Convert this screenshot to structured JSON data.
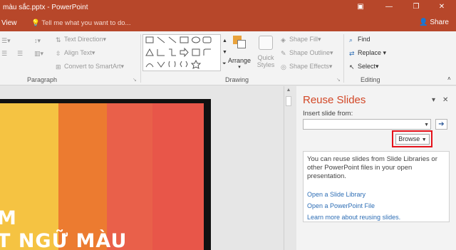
{
  "window": {
    "title": "màu sắc.pptx - PowerPoint",
    "icons": [
      "ribbon-display-icon",
      "minimize-icon",
      "restore-icon",
      "close-icon"
    ]
  },
  "menubar": {
    "view_tab": "View",
    "tellme_placeholder": "Tell me what you want to do...",
    "share_label": "Share"
  },
  "ribbon": {
    "paragraph": {
      "label": "Paragraph",
      "text_direction": "Text Direction",
      "align_text": "Align Text",
      "convert_smartart": "Convert to SmartArt"
    },
    "drawing": {
      "label": "Drawing",
      "arrange": "Arrange",
      "quick": "Quick",
      "styles": "Styles",
      "shape_fill": "Shape Fill",
      "shape_outline": "Shape Outline",
      "shape_effects": "Shape Effects"
    },
    "editing": {
      "label": "Editing",
      "find": "Find",
      "replace": "Replace",
      "select": "Select"
    }
  },
  "slide": {
    "text_line1": "M",
    "text_line2": "T NGỮ MÀU",
    "colors": [
      "#f5c342",
      "#ec7b30",
      "#e9604a",
      "#e85649"
    ]
  },
  "reuse_pane": {
    "title": "Reuse Slides",
    "insert_label": "Insert slide from:",
    "insert_value": "",
    "browse_label": "Browse",
    "info_text": "You can reuse slides from Slide Libraries or other PowerPoint files in your open presentation.",
    "link_library": "Open a Slide Library",
    "link_file": "Open a PowerPoint File",
    "link_learn": "Learn more about reusing slides."
  },
  "colors": {
    "title_bar": "#b7472a",
    "accent": "#d24726",
    "link": "#2e6eb5",
    "highlight": "#e5121b"
  }
}
